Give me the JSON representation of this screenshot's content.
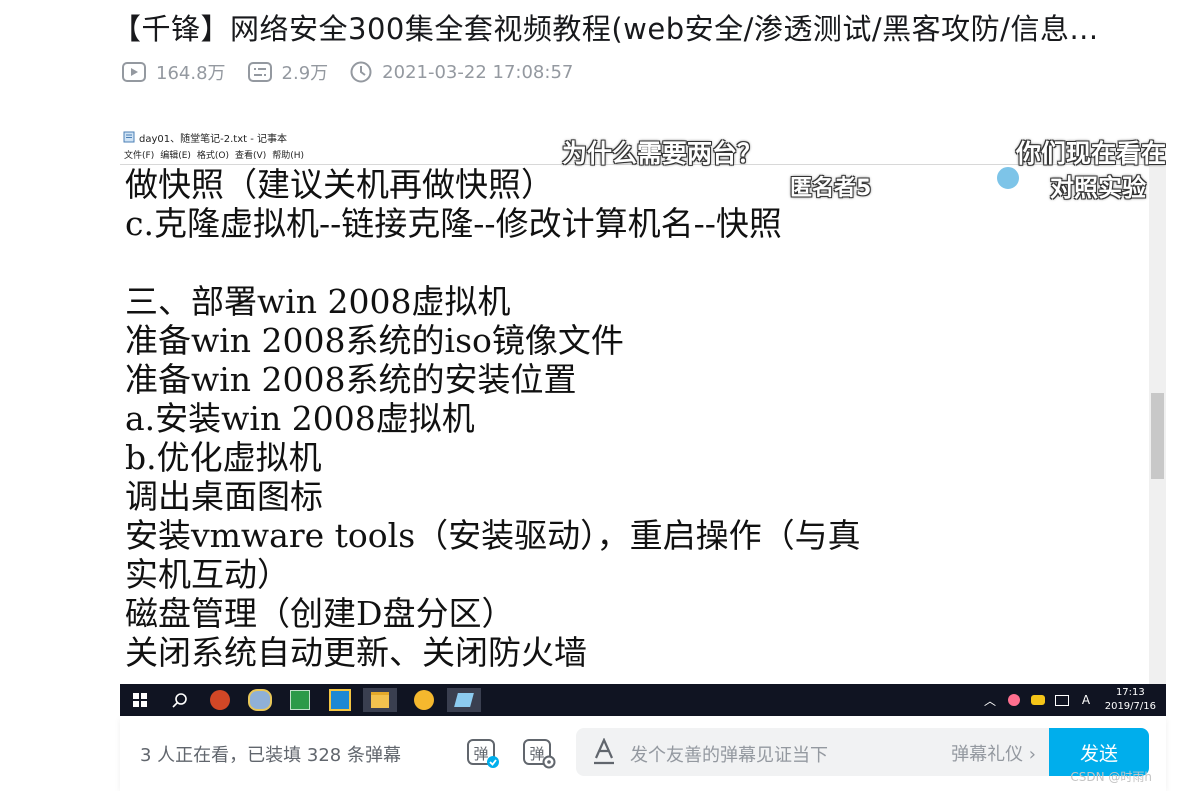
{
  "video": {
    "title": "【千锋】网络安全300集全套视频教程(web安全/渗透测试/黑客攻防/信息...",
    "plays": "164.8万",
    "danmaku_count": "2.9万",
    "publish_time": "2021-03-22 17:08:57"
  },
  "notepad": {
    "window_title": "day01、随堂笔记-2.txt - 记事本",
    "menu": [
      "文件(F)",
      "编辑(E)",
      "格式(O)",
      "查看(V)",
      "帮助(H)"
    ],
    "lines": [
      "        做快照（建议关机再做快照）",
      "    c.克隆虚拟机--链接克隆--修改计算机名--快照",
      "",
      "三、部署win 2008虚拟机",
      "    准备win 2008系统的iso镜像文件",
      "    准备win 2008系统的安装位置",
      "    a.安装win 2008虚拟机",
      "    b.优化虚拟机",
      "        调出桌面图标",
      "        安装vmware tools（安装驱动），重启操作（与真",
      "实机互动）",
      "        磁盘管理（创建D盘分区）",
      "        关闭系统自动更新、关闭防火墙"
    ]
  },
  "overlay_danmaku": [
    {
      "text": "为什么需要两台？"
    },
    {
      "text": "匿名者5"
    },
    {
      "text": "你们现在看在"
    },
    {
      "text": "对照实验"
    }
  ],
  "taskbar": {
    "time": "17:13",
    "date": "2019/7/16"
  },
  "bottom": {
    "watching_text": "3 人正在看，已装填 328 条弹幕",
    "input_placeholder": "发个友善的弹幕见证当下",
    "etiquette": "弹幕礼仪 ›",
    "send_label": "发送"
  },
  "watermark": "CSDN @时雨h",
  "colors": {
    "accent": "#00aeec",
    "taskbar": "#101422",
    "meta": "#9499a0"
  }
}
